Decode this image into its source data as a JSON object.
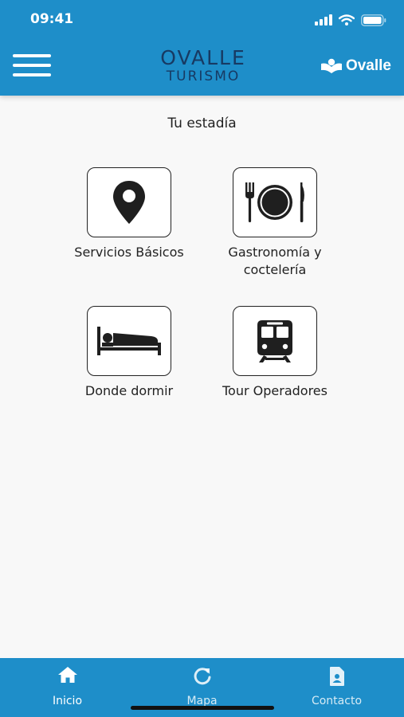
{
  "status_bar": {
    "time": "09:41",
    "icons": [
      "signal-icon",
      "wifi-icon",
      "battery-icon"
    ]
  },
  "header": {
    "menu_icon": "hamburger-menu-icon",
    "logo_line1": "OVALLE",
    "logo_line2": "TURISMO",
    "secondary_logo": "Ovalle"
  },
  "page": {
    "title": "Tu estadía"
  },
  "tiles": [
    {
      "label": "Servicios Básicos",
      "icon": "map-pin-icon"
    },
    {
      "label": "Gastronomía y coctelería",
      "icon": "cutlery-plate-icon"
    },
    {
      "label": "Donde dormir",
      "icon": "bed-icon"
    },
    {
      "label": "Tour Operadores",
      "icon": "train-icon"
    }
  ],
  "bottom_nav": [
    {
      "label": "Inicio",
      "icon": "home-icon",
      "active": true
    },
    {
      "label": "Mapa",
      "icon": "refresh-map-icon",
      "active": false
    },
    {
      "label": "Contacto",
      "icon": "contact-card-icon",
      "active": false
    }
  ],
  "colors": {
    "primary": "#1e8ec9",
    "logo_dark": "#173a63",
    "background": "#f8f8f8",
    "icon_dark": "#1f1f1f"
  }
}
